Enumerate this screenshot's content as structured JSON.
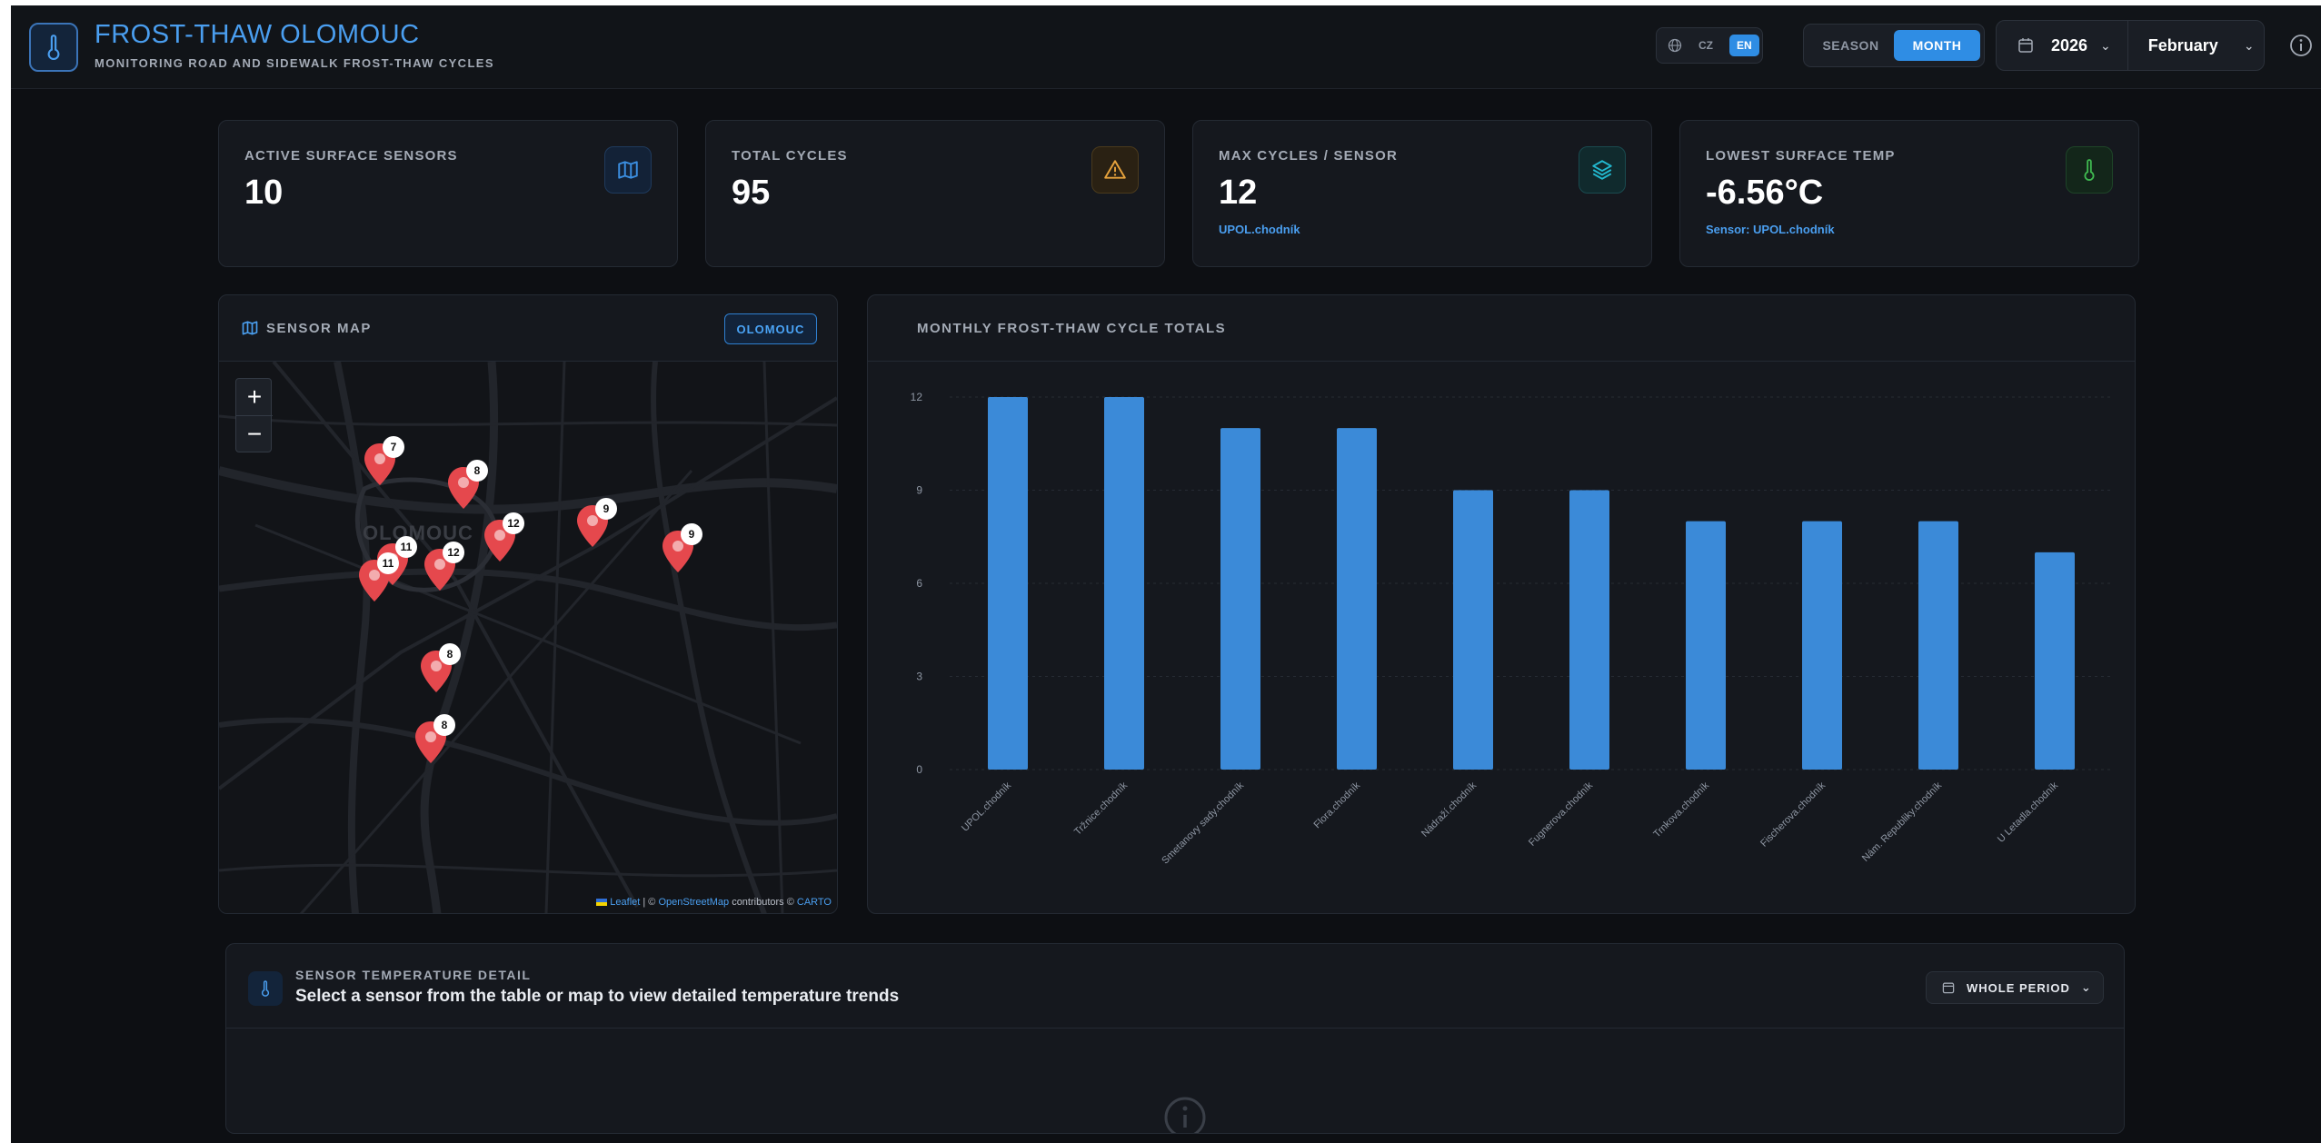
{
  "header": {
    "title": "FROST-THAW OLOMOUC",
    "subtitle": "MONITORING ROAD AND SIDEWALK FROST-THAW CYCLES",
    "lang_options": [
      "CZ",
      "EN"
    ],
    "lang_active": "EN",
    "mode_options": [
      "SEASON",
      "MONTH"
    ],
    "mode_active": "MONTH",
    "year": "2026",
    "month": "February"
  },
  "stats": [
    {
      "label": "ACTIVE SURFACE SENSORS",
      "value": "10",
      "sub": "",
      "icon": "map-icon",
      "color": "#3b8ee0"
    },
    {
      "label": "TOTAL CYCLES",
      "value": "95",
      "sub": "",
      "icon": "warning-icon",
      "color": "#e6a23c"
    },
    {
      "label": "MAX CYCLES / SENSOR",
      "value": "12",
      "sub": "UPOL.chodník",
      "icon": "layers-icon",
      "color": "#22b8cf"
    },
    {
      "label": "LOWEST SURFACE TEMP",
      "value": "-6.56°C",
      "sub": "Sensor: UPOL.chodník",
      "icon": "thermometer-icon",
      "color": "#3fb950"
    }
  ],
  "map": {
    "title": "SENSOR MAP",
    "badge": "OLOMOUC",
    "city_label": "OLOMOUC",
    "zoom_in": "+",
    "zoom_out": "−",
    "attribution_leaflet": "Leaflet",
    "attribution_osm": "OpenStreetMap",
    "attribution_contrib": "contributors ©",
    "attribution_carto": "CARTO",
    "marker_counts": [
      "7",
      "8",
      "12",
      "9",
      "9",
      "11",
      "11",
      "12",
      "8",
      "8"
    ]
  },
  "chart": {
    "title": "MONTHLY FROST-THAW CYCLE TOTALS"
  },
  "chart_data": {
    "type": "bar",
    "categories": [
      "UPOL.chodník",
      "Tržnice.chodník",
      "Smetanovy sady.chodník",
      "Flora.chodník",
      "Nádraží.chodník",
      "Fugnerova.chodník",
      "Trnkova.chodník",
      "Fischerova.chodník",
      "Nám. Republiky.chodník",
      "U Letadla.chodník"
    ],
    "values": [
      12,
      12,
      11,
      11,
      9,
      9,
      8,
      8,
      8,
      7
    ],
    "ylim": [
      0,
      12
    ],
    "yticks": [
      0,
      3,
      6,
      9,
      12
    ],
    "grid": true,
    "bar_color": "#3b8ad8"
  },
  "detail": {
    "title": "SENSOR TEMPERATURE DETAIL",
    "subtitle": "Select a sensor from the table or map to view detailed temperature trends",
    "period": "WHOLE PERIOD"
  }
}
